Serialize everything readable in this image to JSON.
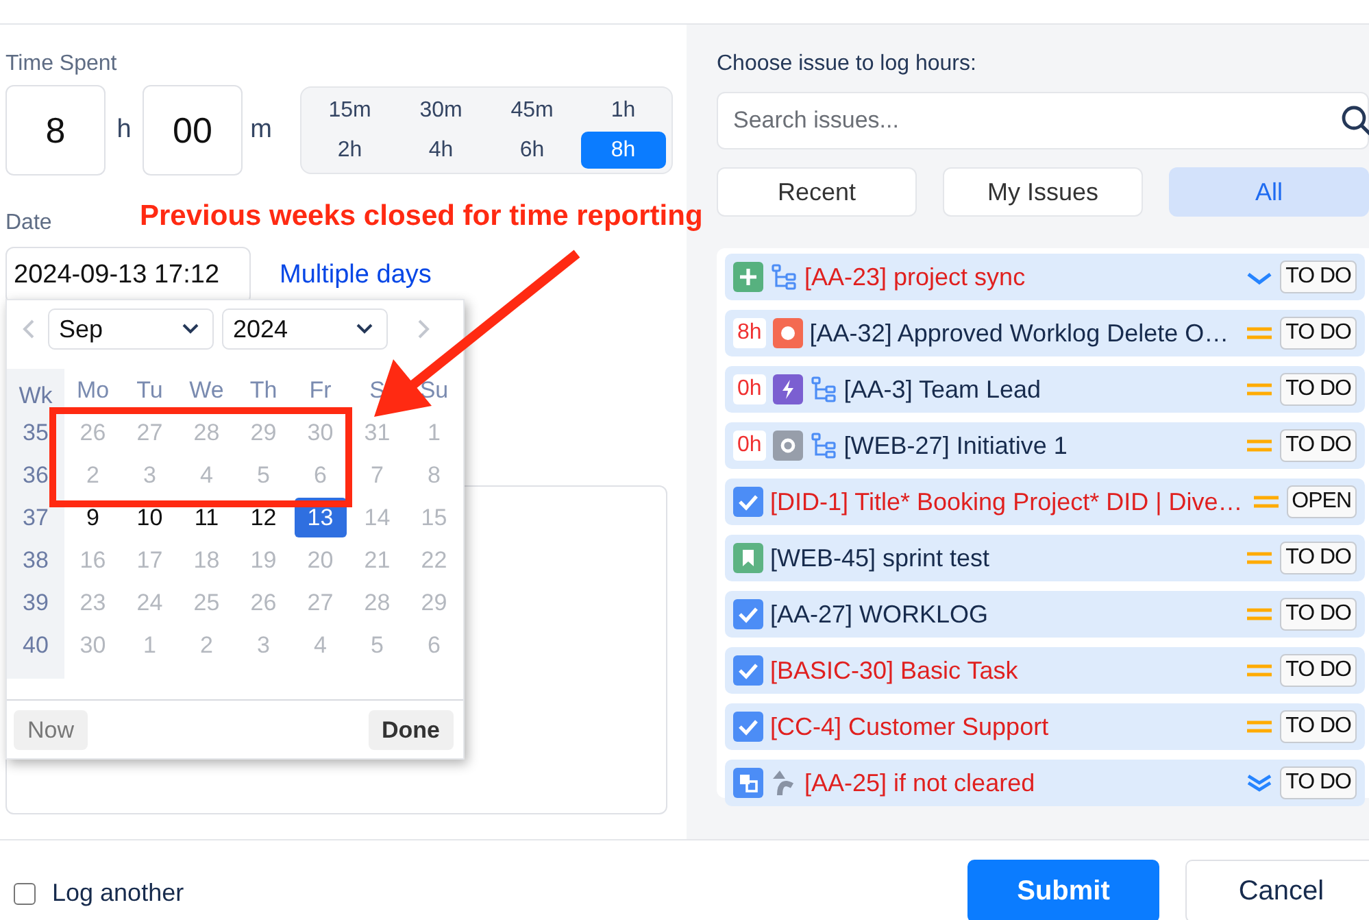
{
  "time_spent": {
    "label": "Time Spent",
    "hours": "8",
    "hours_unit": "h",
    "minutes": "00",
    "minutes_unit": "m",
    "presets": [
      {
        "label": "15m",
        "selected": false
      },
      {
        "label": "30m",
        "selected": false
      },
      {
        "label": "45m",
        "selected": false
      },
      {
        "label": "1h",
        "selected": false
      },
      {
        "label": "2h",
        "selected": false
      },
      {
        "label": "4h",
        "selected": false
      },
      {
        "label": "6h",
        "selected": false
      },
      {
        "label": "8h",
        "selected": true
      }
    ]
  },
  "date": {
    "label": "Date",
    "value": "2024-09-13 17:12",
    "link": "Multiple days"
  },
  "calendar": {
    "month": "Sep",
    "year": "2024",
    "week_header": "Wk",
    "weekdays": [
      "Mo",
      "Tu",
      "We",
      "Th",
      "Fr",
      "S",
      "Su"
    ],
    "weeks": [
      {
        "number": "35",
        "days": [
          {
            "label": "26",
            "disabled": true,
            "selected": false
          },
          {
            "label": "27",
            "disabled": true,
            "selected": false
          },
          {
            "label": "28",
            "disabled": true,
            "selected": false
          },
          {
            "label": "29",
            "disabled": true,
            "selected": false
          },
          {
            "label": "30",
            "disabled": true,
            "selected": false
          },
          {
            "label": "31",
            "disabled": true,
            "selected": false
          },
          {
            "label": "1",
            "disabled": true,
            "selected": false
          }
        ]
      },
      {
        "number": "36",
        "days": [
          {
            "label": "2",
            "disabled": true,
            "selected": false
          },
          {
            "label": "3",
            "disabled": true,
            "selected": false
          },
          {
            "label": "4",
            "disabled": true,
            "selected": false
          },
          {
            "label": "5",
            "disabled": true,
            "selected": false
          },
          {
            "label": "6",
            "disabled": true,
            "selected": false
          },
          {
            "label": "7",
            "disabled": true,
            "selected": false
          },
          {
            "label": "8",
            "disabled": true,
            "selected": false
          }
        ]
      },
      {
        "number": "37",
        "days": [
          {
            "label": "9",
            "disabled": false,
            "selected": false
          },
          {
            "label": "10",
            "disabled": false,
            "selected": false
          },
          {
            "label": "11",
            "disabled": false,
            "selected": false
          },
          {
            "label": "12",
            "disabled": false,
            "selected": false
          },
          {
            "label": "13",
            "disabled": false,
            "selected": true
          },
          {
            "label": "14",
            "disabled": true,
            "selected": false
          },
          {
            "label": "15",
            "disabled": true,
            "selected": false
          }
        ]
      },
      {
        "number": "38",
        "days": [
          {
            "label": "16",
            "disabled": true,
            "selected": false
          },
          {
            "label": "17",
            "disabled": true,
            "selected": false
          },
          {
            "label": "18",
            "disabled": true,
            "selected": false
          },
          {
            "label": "19",
            "disabled": true,
            "selected": false
          },
          {
            "label": "20",
            "disabled": true,
            "selected": false
          },
          {
            "label": "21",
            "disabled": true,
            "selected": false
          },
          {
            "label": "22",
            "disabled": true,
            "selected": false
          }
        ]
      },
      {
        "number": "39",
        "days": [
          {
            "label": "23",
            "disabled": true,
            "selected": false
          },
          {
            "label": "24",
            "disabled": true,
            "selected": false
          },
          {
            "label": "25",
            "disabled": true,
            "selected": false
          },
          {
            "label": "26",
            "disabled": true,
            "selected": false
          },
          {
            "label": "27",
            "disabled": true,
            "selected": false
          },
          {
            "label": "28",
            "disabled": true,
            "selected": false
          },
          {
            "label": "29",
            "disabled": true,
            "selected": false
          }
        ]
      },
      {
        "number": "40",
        "days": [
          {
            "label": "30",
            "disabled": true,
            "selected": false
          },
          {
            "label": "1",
            "disabled": true,
            "selected": false
          },
          {
            "label": "2",
            "disabled": true,
            "selected": false
          },
          {
            "label": "3",
            "disabled": true,
            "selected": false
          },
          {
            "label": "4",
            "disabled": true,
            "selected": false
          },
          {
            "label": "5",
            "disabled": true,
            "selected": false
          },
          {
            "label": "6",
            "disabled": true,
            "selected": false
          }
        ]
      }
    ],
    "now_button": "Now",
    "done_button": "Done"
  },
  "annotation": {
    "text": "Previous weeks closed for time reporting"
  },
  "issue_picker": {
    "label": "Choose issue to log hours:",
    "search": {
      "placeholder": "Search issues..."
    },
    "tabs": [
      {
        "label": "Recent",
        "selected": false
      },
      {
        "label": "My Issues",
        "selected": false
      },
      {
        "label": "All",
        "selected": true
      }
    ],
    "issues": [
      {
        "kind": "feature",
        "link": {
          "kind": "hierarchy"
        },
        "title": "[AA-23] project sync",
        "flagged": true,
        "priority": {
          "kind": "low"
        },
        "status": "TO DO"
      },
      {
        "time": "8h",
        "kind": "bug",
        "title": "[AA-32] Approved Worklog Delete O…",
        "flagged": false,
        "priority": {
          "kind": "medium"
        },
        "status": "TO DO"
      },
      {
        "time": "0h",
        "kind": "epic",
        "link": {
          "kind": "hierarchy"
        },
        "title": "[AA-3] Team Lead",
        "flagged": false,
        "priority": {
          "kind": "medium"
        },
        "status": "TO DO"
      },
      {
        "time": "0h",
        "kind": "initiative",
        "link": {
          "kind": "hierarchy"
        },
        "title": "[WEB-27] Initiative 1",
        "flagged": false,
        "priority": {
          "kind": "medium"
        },
        "status": "TO DO"
      },
      {
        "kind": "task",
        "title": "[DID-1] Title* Booking Project* DID | Dive…",
        "flagged": true,
        "priority": {
          "kind": "medium"
        },
        "status": "OPEN"
      },
      {
        "kind": "story",
        "title": "[WEB-45] sprint test",
        "flagged": false,
        "priority": {
          "kind": "medium"
        },
        "status": "TO DO"
      },
      {
        "kind": "task",
        "title": "[AA-27] WORKLOG",
        "flagged": false,
        "priority": {
          "kind": "medium"
        },
        "status": "TO DO"
      },
      {
        "kind": "task",
        "title": "[BASIC-30] Basic Task",
        "flagged": true,
        "priority": {
          "kind": "medium"
        },
        "status": "TO DO"
      },
      {
        "kind": "task",
        "title": "[CC-4] Customer Support",
        "flagged": true,
        "priority": {
          "kind": "medium"
        },
        "status": "TO DO"
      },
      {
        "kind": "subtask",
        "link": {
          "kind": "return"
        },
        "title": "[AA-25] if not cleared",
        "flagged": true,
        "priority": {
          "kind": "lowest"
        },
        "status": "TO DO"
      }
    ]
  },
  "log_another": {
    "label": "Log another",
    "checked": false
  },
  "buttons": {
    "submit": "Submit",
    "cancel": "Cancel"
  }
}
